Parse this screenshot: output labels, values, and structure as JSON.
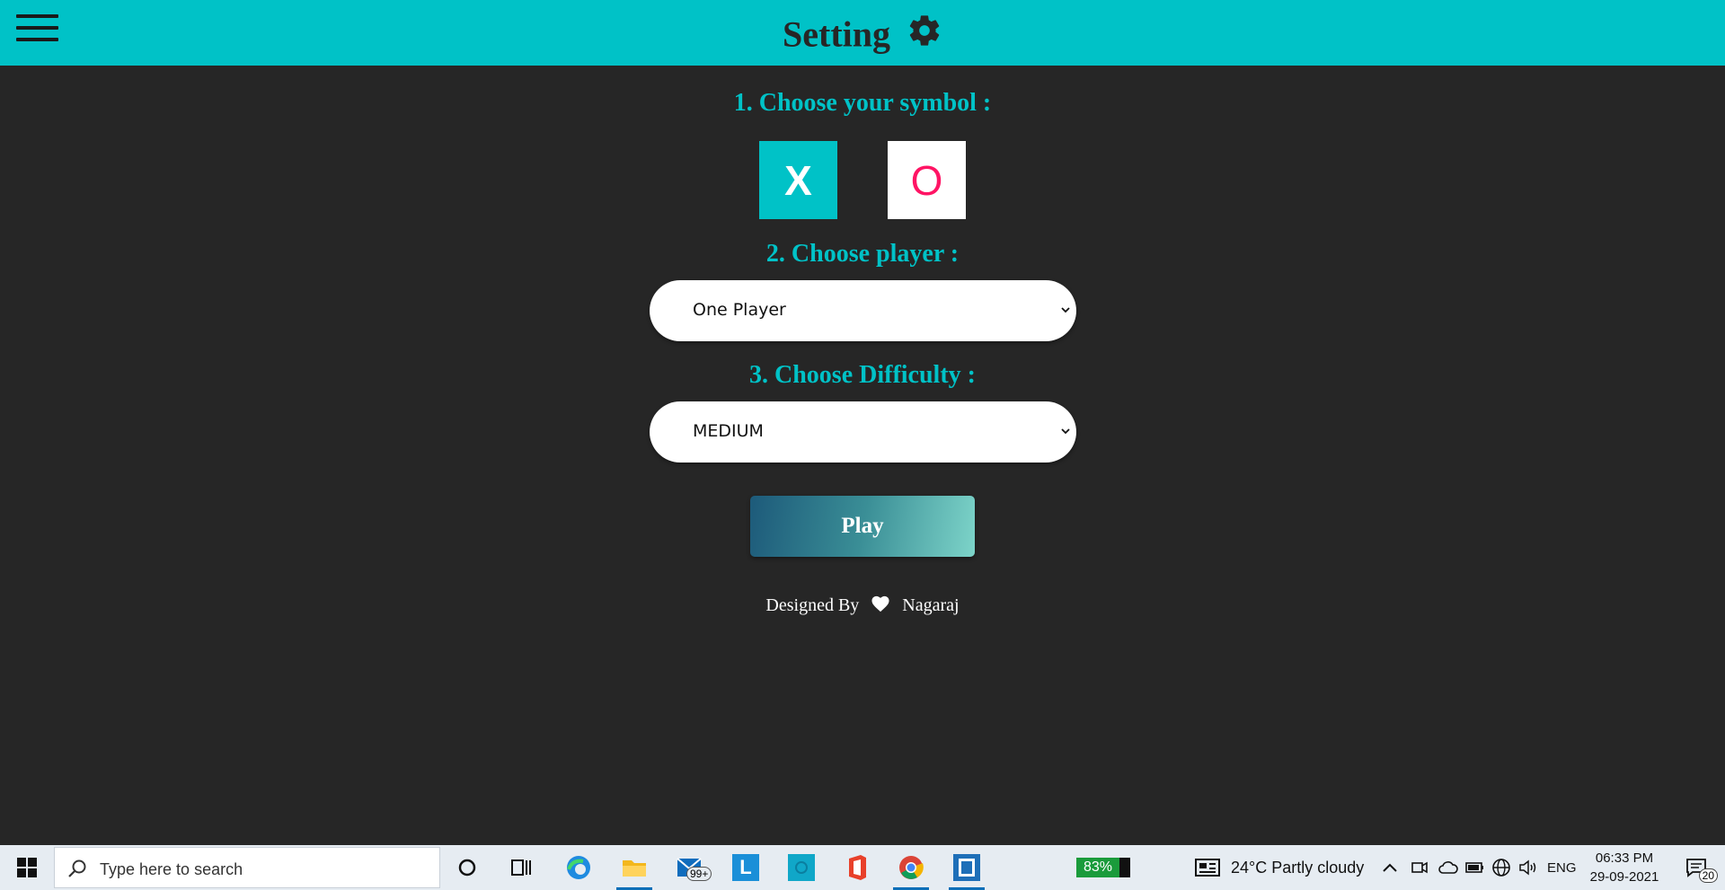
{
  "header": {
    "title": "Setting",
    "menu_icon": "hamburger-menu-icon",
    "title_icon": "gear-icon",
    "bg_color": "#00c2c7"
  },
  "settings": {
    "symbol_title": "1. Choose your symbol :",
    "symbols": [
      {
        "label": "X",
        "selected": true,
        "color": "#ffffff",
        "bg": "#00c2c7"
      },
      {
        "label": "O",
        "selected": false,
        "color": "#ff1464",
        "bg": "#ffffff"
      }
    ],
    "player_title": "2. Choose player :",
    "player_select": {
      "value": "One Player"
    },
    "difficulty_title": "3. Choose Difficulty :",
    "difficulty_select": {
      "value": "MEDIUM"
    },
    "play_label": "Play"
  },
  "footer": {
    "designed_by": "Designed By",
    "author": "Nagaraj",
    "heart_icon": "heart-icon"
  },
  "taskbar": {
    "search_placeholder": "Type here to search",
    "mail_badge": "99+",
    "battery": "83%",
    "weather": "24°C  Partly cloudy",
    "language": "ENG",
    "time": "06:33 PM",
    "date": "29-09-2021",
    "notifications": "20"
  }
}
